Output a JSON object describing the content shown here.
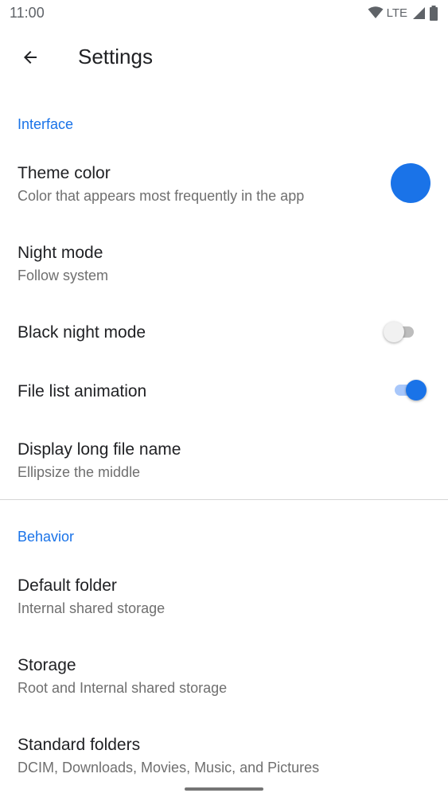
{
  "status_bar": {
    "time": "11:00",
    "network": "LTE",
    "icons": [
      "wifi-icon",
      "cell-signal-icon",
      "battery-icon"
    ]
  },
  "app_bar": {
    "back_icon": "arrow-back-icon",
    "title": "Settings"
  },
  "colors": {
    "accent": "#1a73e8",
    "section_header": "#1a73e8",
    "summary_text": "#6f6f6f"
  },
  "sections": {
    "interface": {
      "header": "Interface",
      "theme_color": {
        "title": "Theme color",
        "summary": "Color that appears most frequently in the app",
        "value": "#1a73e8"
      },
      "night_mode": {
        "title": "Night mode",
        "summary": "Follow system"
      },
      "black_night_mode": {
        "title": "Black night mode",
        "checked": false
      },
      "file_list_animation": {
        "title": "File list animation",
        "checked": true
      },
      "display_long_file_name": {
        "title": "Display long file name",
        "summary": "Ellipsize the middle"
      }
    },
    "behavior": {
      "header": "Behavior",
      "default_folder": {
        "title": "Default folder",
        "summary": "Internal shared storage"
      },
      "storage": {
        "title": "Storage",
        "summary": "Root and Internal shared storage"
      },
      "standard_folders": {
        "title": "Standard folders",
        "summary": "DCIM, Downloads, Movies, Music, and Pictures"
      }
    }
  }
}
